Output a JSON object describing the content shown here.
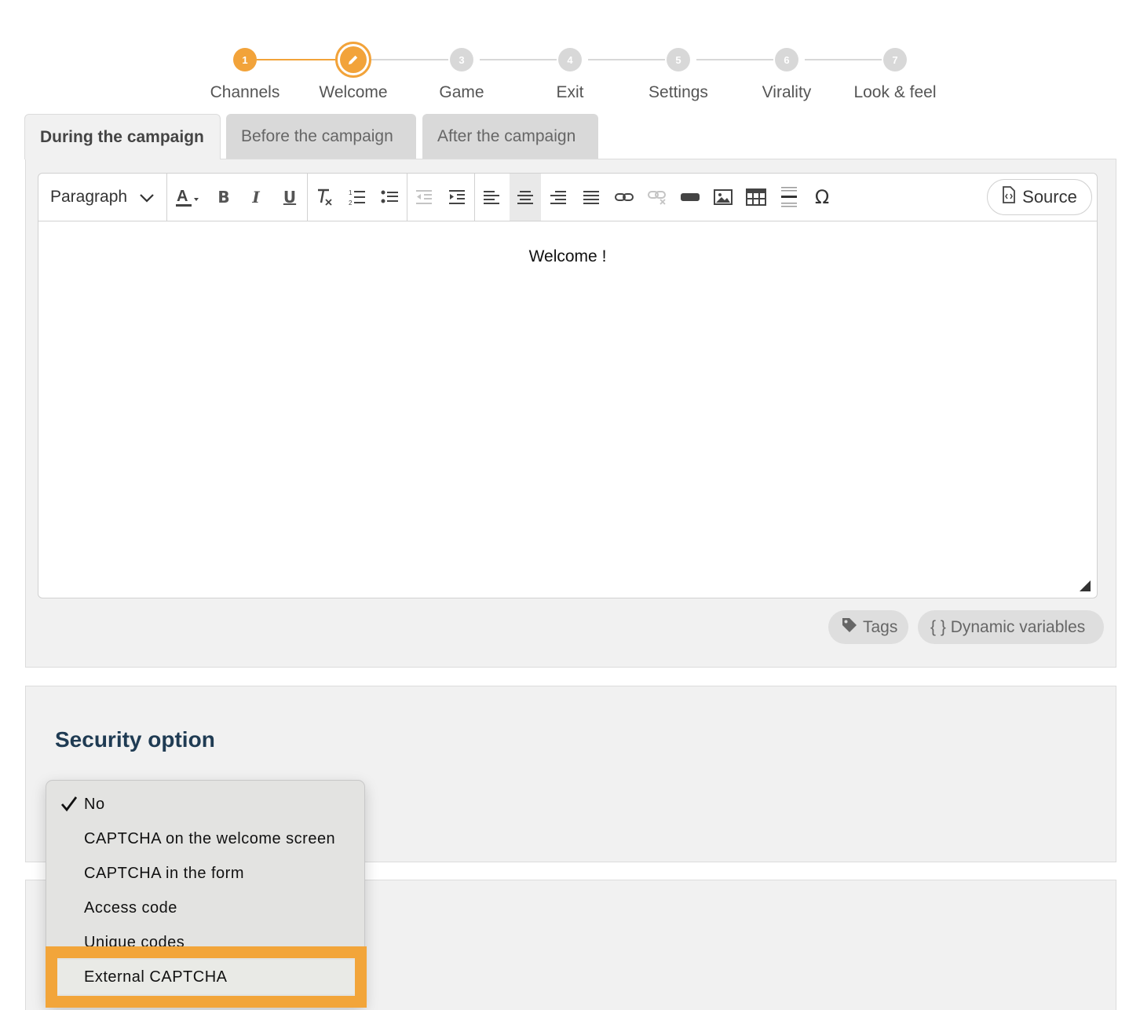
{
  "stepper": {
    "steps": [
      {
        "number": "1",
        "label": "Channels"
      },
      {
        "number": "",
        "label": "Welcome"
      },
      {
        "number": "3",
        "label": "Game"
      },
      {
        "number": "4",
        "label": "Exit"
      },
      {
        "number": "5",
        "label": "Settings"
      },
      {
        "number": "6",
        "label": "Virality"
      },
      {
        "number": "7",
        "label": "Look & feel"
      }
    ],
    "current_icon": "pencil-icon",
    "accent_color": "#f2a33a"
  },
  "tabs": [
    {
      "label": "During the campaign",
      "active": true
    },
    {
      "label": "Before the campaign",
      "active": false
    },
    {
      "label": "After the campaign",
      "active": false
    }
  ],
  "editor": {
    "format_select": "Paragraph",
    "source_label": "Source",
    "content": "Welcome !",
    "toolbar_icons": [
      "text-color-icon",
      "bold-icon",
      "italic-icon",
      "underline-icon",
      "remove-format-icon",
      "numbered-list-icon",
      "bulleted-list-icon",
      "outdent-icon",
      "indent-icon",
      "align-left-icon",
      "align-center-icon",
      "align-right-icon",
      "justify-icon",
      "link-icon",
      "unlink-icon",
      "button-icon",
      "image-icon",
      "table-icon",
      "horizontal-line-icon",
      "special-char-icon"
    ],
    "toolbar_glyphs": {
      "bold": "B",
      "italic": "I",
      "underline": "U",
      "special": "Ω"
    }
  },
  "pills": {
    "tags": "Tags",
    "dynamic_variables": "{ } Dynamic variables"
  },
  "security": {
    "title": "Security option",
    "options": [
      "No",
      "CAPTCHA on the welcome screen",
      "CAPTCHA in the form",
      "Access code",
      "Unique codes",
      "External CAPTCHA"
    ],
    "selected": "No",
    "highlighted": "External CAPTCHA",
    "highlight_color": "#f2a53a"
  }
}
